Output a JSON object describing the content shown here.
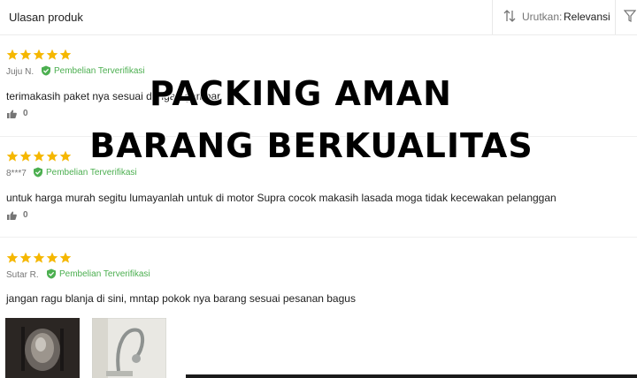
{
  "header": {
    "title": "Ulasan produk",
    "sort_label": "Urutkan:",
    "sort_value": "Relevansi"
  },
  "overlay": {
    "line1": "PACKING AMAN",
    "line2": "BARANG BERKUALITAS"
  },
  "reviews": [
    {
      "rating": 5,
      "reviewer": "Juju N.",
      "verified": "Pembelian Terverifikasi",
      "text": "terimakasih paket nya sesuai dengan gambar",
      "likes": "0"
    },
    {
      "rating": 5,
      "reviewer": "8***7",
      "verified": "Pembelian Terverifikasi",
      "text": "untuk harga murah segitu lumayanlah untuk di motor Supra cocok makasih lasada moga tidak kecewakan pelanggan",
      "likes": "0"
    },
    {
      "rating": 5,
      "reviewer": "Sutar R.",
      "verified": "Pembelian Terverifikasi",
      "text": "jangan ragu blanja di sini, mntap pokok nya barang sesuai pesanan bagus",
      "likes": ""
    }
  ],
  "colors": {
    "star": "#f5b700",
    "verified": "#4caf50",
    "muted": "#757575"
  }
}
